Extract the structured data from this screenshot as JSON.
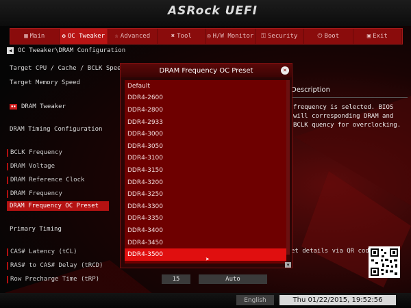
{
  "brand": "ASRock UEFI",
  "tabs": [
    {
      "icon": "▦",
      "label": "Main"
    },
    {
      "icon": "✪",
      "label": "OC Tweaker"
    },
    {
      "icon": "☆",
      "label": "Advanced"
    },
    {
      "icon": "✖",
      "label": "Tool"
    },
    {
      "icon": "◎",
      "label": "H/W Monitor"
    },
    {
      "icon": "⚿",
      "label": "Security"
    },
    {
      "icon": "⏻",
      "label": "Boot"
    },
    {
      "icon": "▣",
      "label": "Exit"
    }
  ],
  "breadcrumb": "OC Tweaker\\DRAM Configuration",
  "left": {
    "target_cpu": "Target CPU / Cache / BCLK Speed",
    "target_mem": "Target Memory Speed",
    "dram_tweaker": "DRAM Tweaker",
    "dram_timing": "DRAM Timing Configuration",
    "bclk": "BCLK Frequency",
    "voltage": "DRAM Voltage",
    "refclock": "DRAM Reference Clock",
    "freq": "DRAM Frequency",
    "preset": "DRAM Frequency OC Preset",
    "primary": "Primary Timing",
    "cas": "CAS# Latency (tCL)",
    "ras": "RAS# to CAS# Delay (tRCD)",
    "rp": "Row Precharge Time (tRP)",
    "rp_value": "15",
    "rp_mode": "Auto"
  },
  "description": {
    "title": "Description",
    "text": "frequency is selected. BIOS will corresponding DRAM and BCLK quency for overclocking.",
    "qr": "et details via QR code"
  },
  "popup": {
    "title": "DRAM Frequency OC Preset",
    "options": [
      "Default",
      "DDR4-2600",
      "DDR4-2800",
      "DDR4-2933",
      "DDR4-3000",
      "DDR4-3050",
      "DDR4-3100",
      "DDR4-3150",
      "DDR4-3200",
      "DDR4-3250",
      "DDR4-3300",
      "DDR4-3350",
      "DDR4-3400",
      "DDR4-3450",
      "DDR4-3500"
    ],
    "selected_index": 14
  },
  "status": {
    "language": "English",
    "datetime": "Thu 01/22/2015, 19:52:56"
  }
}
